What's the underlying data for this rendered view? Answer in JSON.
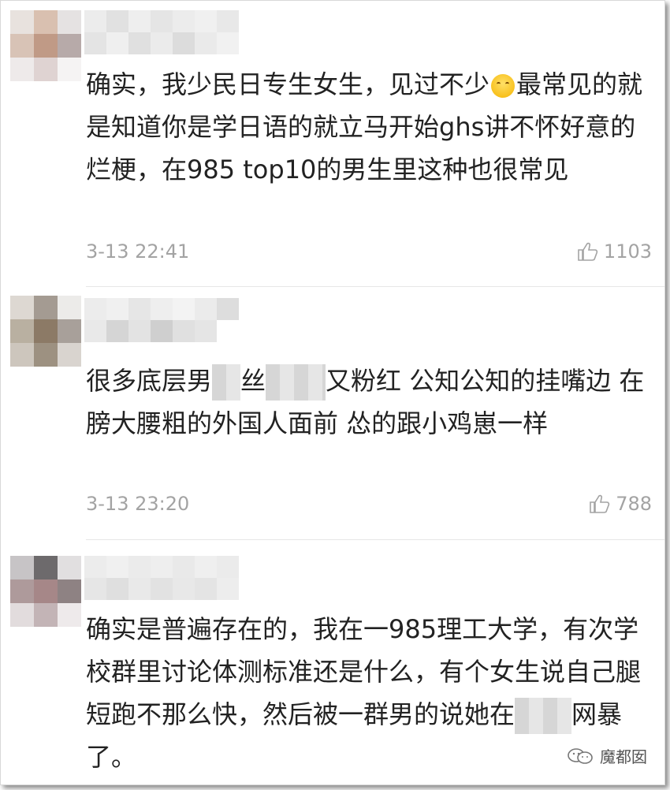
{
  "comments": [
    {
      "text_before_emoji": "确实，我少民日专生女生，见过不少",
      "text_after_emoji": "最常见的就是知道你是学日语的就立马开始ghs讲不怀好意的烂梗，在985 top10的男生里这种也很常见",
      "time": "3-13 22:41",
      "likes": "1103"
    },
    {
      "part1": "很多底层男",
      "part2": "丝",
      "part3": "又粉红 公知公知的挂嘴边 在膀大腰粗的外国人面前 怂的跟小鸡崽一样",
      "time": "3-13 23:20",
      "likes": "788"
    },
    {
      "part1": "确实是普遍存在的，我在一985理工大学，有次学校群里讨论体测标准还是什么，有个女生说自己腿短跑不那么快，然后被一群男的说她在",
      "part2": "网暴了。"
    }
  ],
  "watermark": {
    "label": "魔都囡",
    "icon": "wechat-icon"
  },
  "colors": {
    "text": "#222222",
    "meta": "#a3a3a3",
    "divider": "#e6e6e6"
  }
}
